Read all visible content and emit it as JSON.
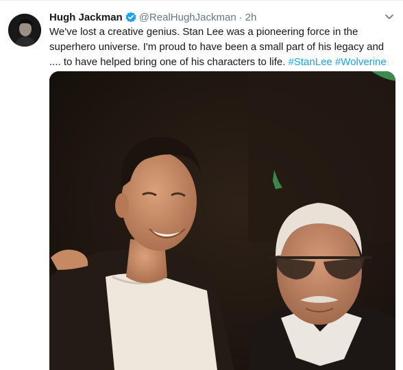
{
  "tweet": {
    "author_name": "Hugh Jackman",
    "handle": "@RealHughJackman",
    "separator": "·",
    "time": "2h",
    "text_part1": "We've lost a creative genius. Stan Lee was a pioneering force in the superhero universe. I'm proud to have been a small part of his legacy and .... to have helped bring one of his characters to life. ",
    "hashtag1": "#StanLee",
    "space": " ",
    "hashtag2": "#Wolverine"
  },
  "icons": {
    "verified": "verified-badge-icon",
    "more": "chevron-down-icon"
  },
  "colors": {
    "link": "#1da1f2",
    "secondary_text": "#657786",
    "primary_text": "#14171a",
    "photo_background": "#1f1710"
  }
}
